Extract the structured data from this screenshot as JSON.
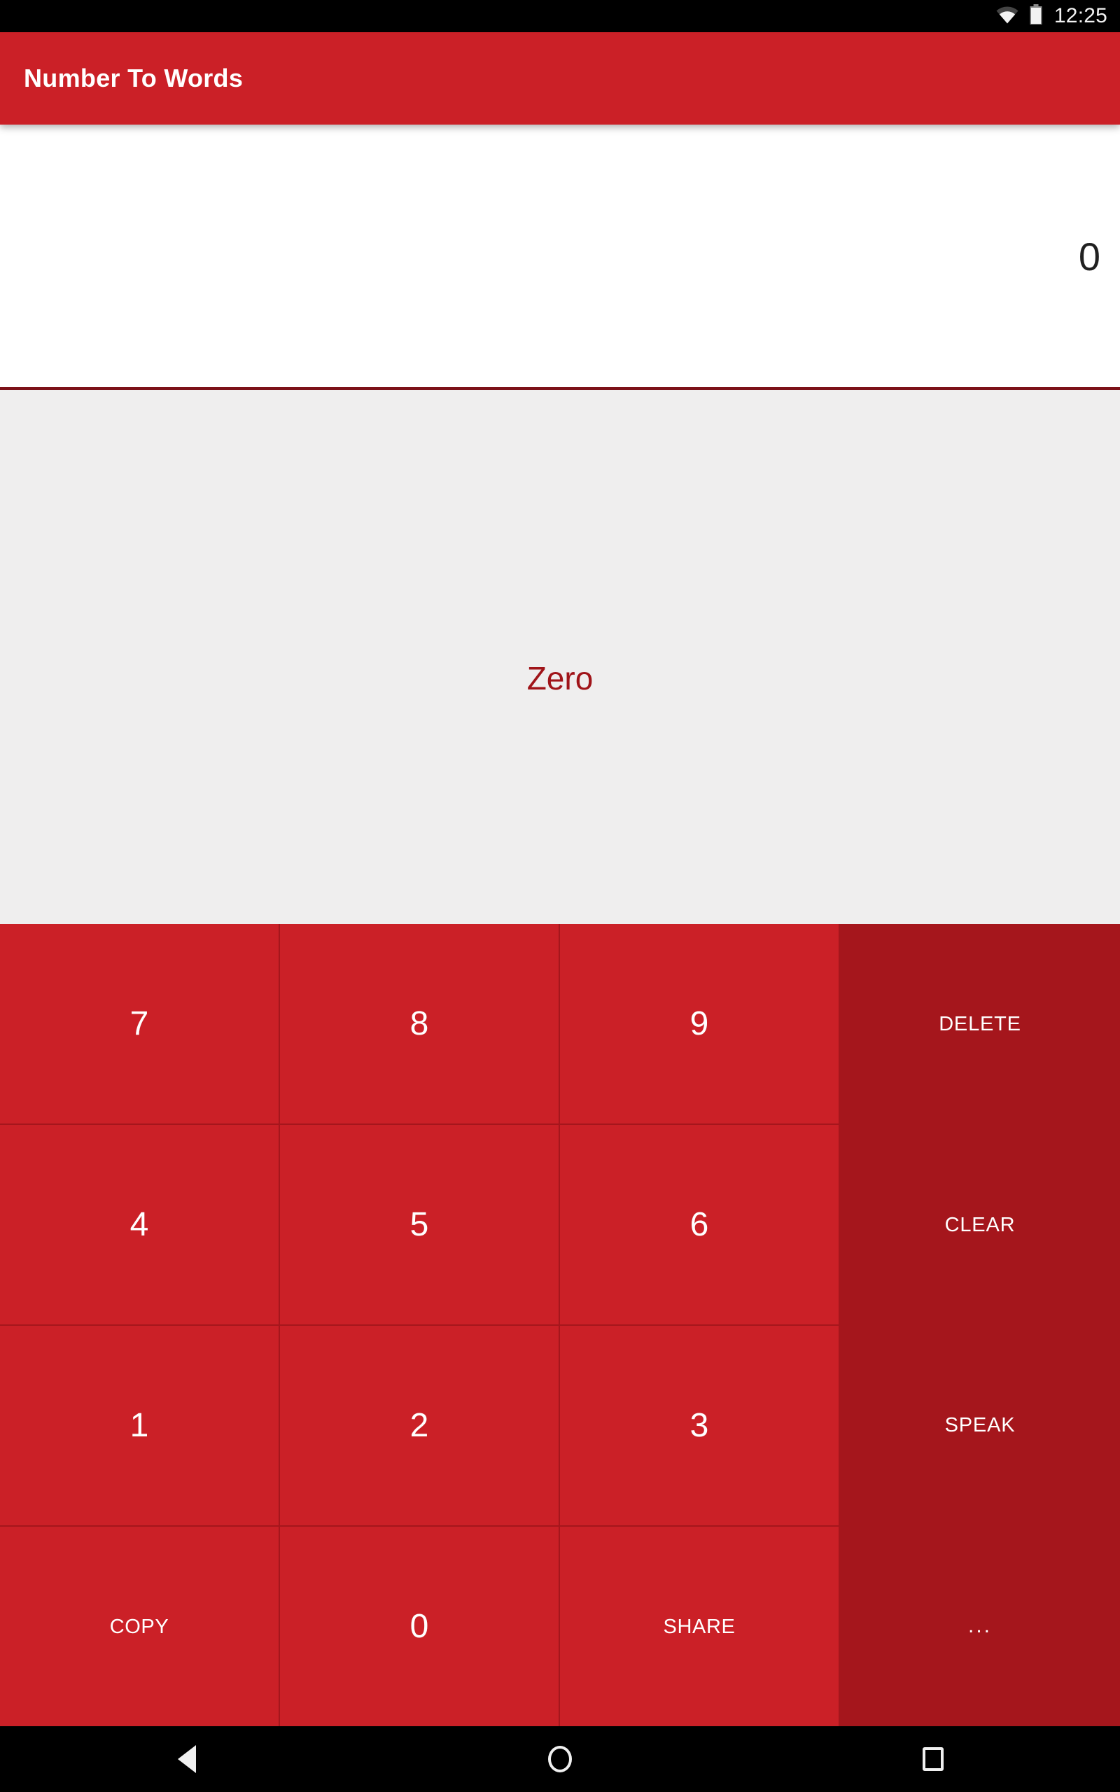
{
  "status_bar": {
    "time": "12:25",
    "wifi_icon": "wifi-icon",
    "battery_icon": "battery-icon"
  },
  "app_bar": {
    "title": "Number To Words",
    "background_color": "#CB2027"
  },
  "input_area": {
    "value": "0",
    "background_color": "#FFFFFF",
    "divider_color": "#7C1118"
  },
  "result_area": {
    "text": "Zero",
    "text_color": "#A01419",
    "background_color": "#EFEEEE"
  },
  "keypad": {
    "key_background": "#CB2027",
    "side_background": "#A5161C",
    "rows": [
      [
        {
          "label": "7",
          "type": "num",
          "name": "key-7"
        },
        {
          "label": "8",
          "type": "num",
          "name": "key-8"
        },
        {
          "label": "9",
          "type": "num",
          "name": "key-9"
        }
      ],
      [
        {
          "label": "4",
          "type": "num",
          "name": "key-4"
        },
        {
          "label": "5",
          "type": "num",
          "name": "key-5"
        },
        {
          "label": "6",
          "type": "num",
          "name": "key-6"
        }
      ],
      [
        {
          "label": "1",
          "type": "num",
          "name": "key-1"
        },
        {
          "label": "2",
          "type": "num",
          "name": "key-2"
        },
        {
          "label": "3",
          "type": "num",
          "name": "key-3"
        }
      ],
      [
        {
          "label": "COPY",
          "type": "word",
          "name": "key-copy"
        },
        {
          "label": "0",
          "type": "num",
          "name": "key-0"
        },
        {
          "label": "SHARE",
          "type": "word",
          "name": "key-share"
        }
      ]
    ],
    "side_keys": [
      {
        "label": "DELETE",
        "name": "key-delete"
      },
      {
        "label": "CLEAR",
        "name": "key-clear"
      },
      {
        "label": "SPEAK",
        "name": "key-speak"
      },
      {
        "label": "...",
        "name": "key-more"
      }
    ]
  },
  "nav_bar": {
    "back_icon": "back-triangle-icon",
    "home_icon": "home-circle-icon",
    "recents_icon": "recents-square-icon"
  }
}
